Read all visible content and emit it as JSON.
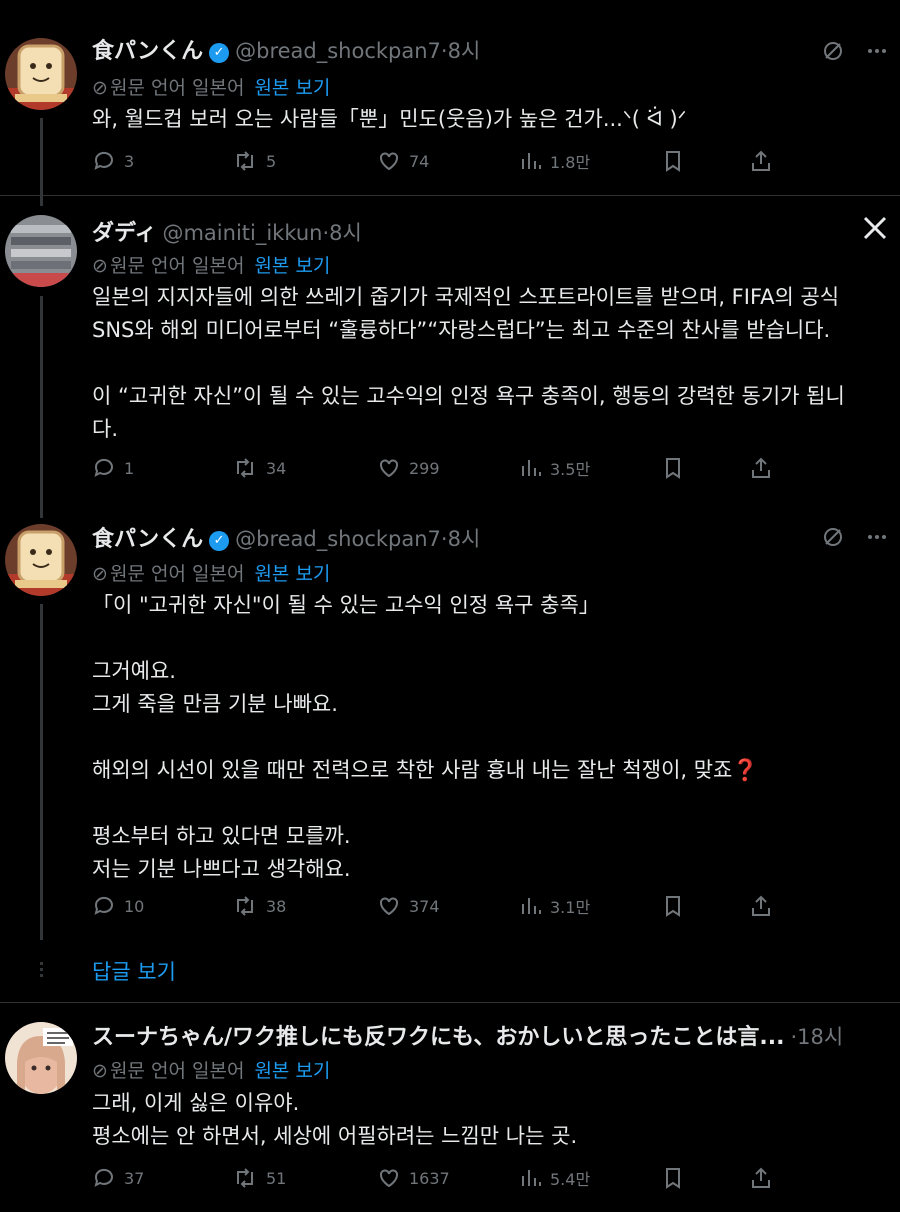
{
  "tweets": [
    {
      "name": "食パンくん",
      "handle": "@bread_shockpan7",
      "sep": "·",
      "time": "8시",
      "translation": {
        "label": "원문 언어 일본어",
        "link": "원본 보기"
      },
      "body": [
        "와, 월드컵 보러 오는 사람들「뿐」민도(웃음)가 높은 건가...ᐠ( ᐛ )ᐟ"
      ],
      "stats": {
        "replies": "3",
        "retweets": "5",
        "likes": "74",
        "views": "1.8만"
      }
    },
    {
      "name": "ダディ",
      "handle": "@mainiti_ikkun",
      "sep": "·",
      "time": "8시",
      "corner_icon": "X",
      "translation": {
        "label": "원문 언어 일본어",
        "link": "원본 보기"
      },
      "body": [
        "일본의 지지자들에 의한 쓰레기 줍기가 국제적인 스포트라이트를 받으며, FIFA의 공식",
        "SNS와 해외 미디어로부터 “훌륭하다”“자랑스럽다”는 최고 수준의 찬사를 받습니다.",
        "",
        "이 “고귀한 자신”이 될 수 있는 고수익의 인정 욕구 충족이, 행동의 강력한 동기가 됩니",
        "다."
      ],
      "stats": {
        "replies": "1",
        "retweets": "34",
        "likes": "299",
        "views": "3.5만"
      }
    },
    {
      "name": "食パンくん",
      "handle": "@bread_shockpan7",
      "sep": "·",
      "time": "8시",
      "translation": {
        "label": "원문 언어 일본어",
        "link": "원본 보기"
      },
      "body": [
        "「이 \"고귀한 자신\"이 될 수 있는 고수익 인정 욕구 충족」",
        "",
        "그거예요.",
        "그게 죽을 만큼 기분 나빠요.",
        "",
        "해외의 시선이 있을 때만 전력으로 착한 사람 흉내 내는 잘난 척쟁이, 맞죠❓",
        "",
        "평소부터 하고 있다면 모를까.",
        "저는 기분 나쁘다고 생각해요."
      ],
      "stats": {
        "replies": "10",
        "retweets": "38",
        "likes": "374",
        "views": "3.1만"
      }
    },
    {
      "name": "スーナちゃん/ワク推しにも反ワクにも、おかしいと思ったことは言...",
      "handle": "",
      "sep": "·",
      "time": "18시",
      "translation": {
        "label": "원문 언어 일본어",
        "link": "원본 보기"
      },
      "body": [
        "그래, 이게 싫은 이유야.",
        "평소에는 안 하면서, 세상에 어필하려는 느낌만 나는 곳."
      ],
      "stats": {
        "replies": "37",
        "retweets": "51",
        "likes": "1637",
        "views": "5.4만"
      }
    }
  ],
  "show_replies": "답글 보기",
  "colors": {
    "background": "#000000",
    "text": "#e7e9ea",
    "muted": "#71767b",
    "accent": "#1d9bf0"
  }
}
